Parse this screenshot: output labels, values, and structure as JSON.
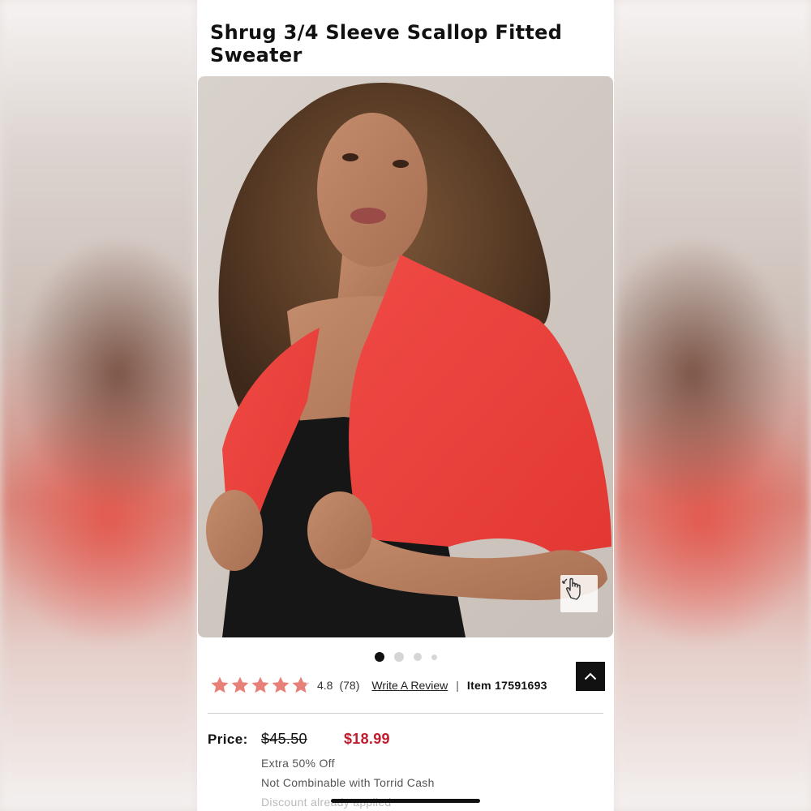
{
  "product": {
    "title": "Shrug 3/4 Sleeve Scallop Fitted Sweater"
  },
  "gallery": {
    "image_count": 4,
    "active_index": 0,
    "zoom_icon": "hand-pointer-icon"
  },
  "rating": {
    "stars": 4.8,
    "max_stars": 5,
    "score_text": "4.8",
    "count_text": "(78)",
    "write_review_label": "Write A Review",
    "separator": "|",
    "item_label": "Item 17591693"
  },
  "price": {
    "label": "Price:",
    "original": "$45.50",
    "sale": "$18.99"
  },
  "promo": {
    "line1": "Extra 50% Off",
    "line2": "Not Combinable with Torrid Cash",
    "line3": "Discount already applied"
  },
  "colors": {
    "sale_red": "#c01c2e",
    "star_color": "#e8807a",
    "text_dark": "#111111"
  }
}
